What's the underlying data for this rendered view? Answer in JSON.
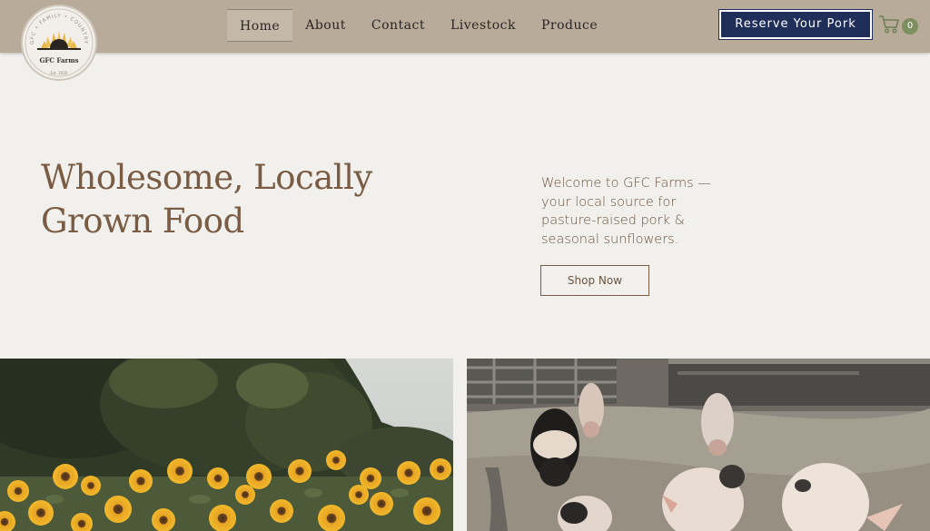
{
  "brand": {
    "logo_ring_text": "GFC • FAMILY • COUNTRY",
    "logo_name": "GFC Farms",
    "logo_est": "Est. 2020"
  },
  "nav": {
    "items": [
      {
        "label": "Home",
        "active": true
      },
      {
        "label": "About",
        "active": false
      },
      {
        "label": "Contact",
        "active": false
      },
      {
        "label": "Livestock",
        "active": false
      },
      {
        "label": "Produce",
        "active": false
      }
    ]
  },
  "header": {
    "reserve_label": "Reserve Your Pork",
    "cart_count": "0",
    "cart_icon": "cart-icon"
  },
  "hero": {
    "title_line1": "Wholesome, Locally",
    "title_line2": "Grown Food",
    "text_line1": "Welcome to GFC Farms —",
    "text_line2": "your local source for",
    "text_line3": "pasture-raised pork &",
    "text_line4": "seasonal sunflowers.",
    "cta_label": "Shop Now"
  },
  "colors": {
    "header_bg": "#b8ab9a",
    "page_bg": "#f2f0ec",
    "accent_navy": "#1f2f5a",
    "heading_brown": "#7a5c45",
    "cart_badge": "#7d8f5e"
  }
}
